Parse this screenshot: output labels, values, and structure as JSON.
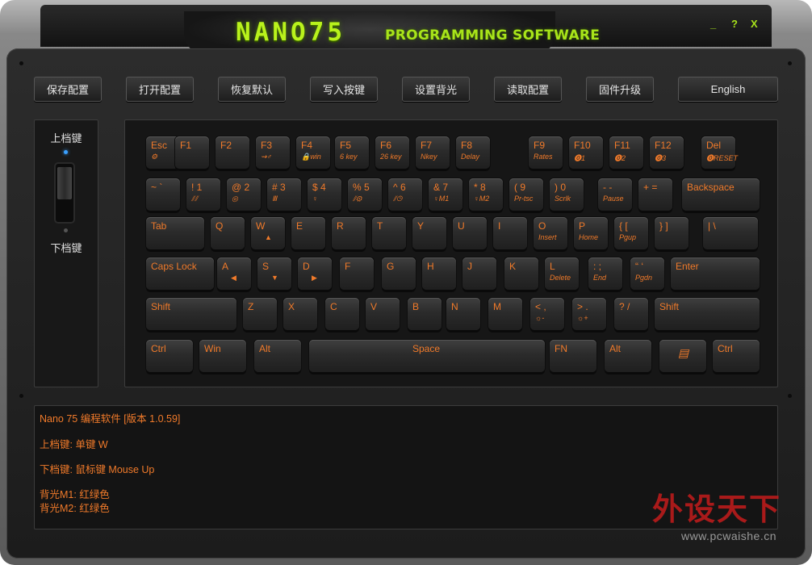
{
  "window": {
    "logo": "NANO75",
    "subtitle": "PROGRAMMING SOFTWARE",
    "minimize": "_",
    "help": "?",
    "close": "X"
  },
  "toolbar": [
    "保存配置",
    "打开配置",
    "恢复默认",
    "写入按键",
    "设置背光",
    "读取配置",
    "固件升级",
    "English"
  ],
  "side": {
    "upper": "上档键",
    "lower": "下档键"
  },
  "keys": [
    {
      "label": "Esc",
      "sub": "⚙"
    },
    {
      "label": "F1",
      "sub": ""
    },
    {
      "label": "F2",
      "sub": ""
    },
    {
      "label": "F3",
      "sub": "⇝♂"
    },
    {
      "label": "F4",
      "sub": "🔒win"
    },
    {
      "label": "F5",
      "sub": "6 key"
    },
    {
      "label": "F6",
      "sub": "26 key"
    },
    {
      "label": "F7",
      "sub": "Nkey"
    },
    {
      "label": "F8",
      "sub": "Delay"
    },
    {
      "label": "F9",
      "sub": "Rates"
    },
    {
      "label": "F10",
      "sub": "⓿1"
    },
    {
      "label": "F11",
      "sub": "⓿2"
    },
    {
      "label": "F12",
      "sub": "⓿3"
    },
    {
      "label": "Del",
      "sub": "⓿RESET"
    },
    {
      "label": "~  `",
      "sub": ""
    },
    {
      "label": "!   1",
      "sub": "⫽⫽"
    },
    {
      "label": "@  2",
      "sub": "◎"
    },
    {
      "label": "#  3",
      "sub": "Ⅲ"
    },
    {
      "label": "$  4",
      "sub": "♀"
    },
    {
      "label": "%  5",
      "sub": "⫽⚙"
    },
    {
      "label": "^  6",
      "sub": "⫽◷"
    },
    {
      "label": "&  7",
      "sub": "♀M1"
    },
    {
      "label": "*   8",
      "sub": "♀M2"
    },
    {
      "label": "(  9",
      "sub": "Pr-tsc"
    },
    {
      "label": ")  0",
      "sub": "Scrlk"
    },
    {
      "label": "-   -",
      "sub": "Pause"
    },
    {
      "label": "+  =",
      "sub": ""
    },
    {
      "label": "Backspace",
      "sub": ""
    },
    {
      "label": "Tab",
      "sub": ""
    },
    {
      "label": "Q",
      "sub": ""
    },
    {
      "label": "W",
      "sub": "▲"
    },
    {
      "label": "E",
      "sub": ""
    },
    {
      "label": "R",
      "sub": ""
    },
    {
      "label": "T",
      "sub": ""
    },
    {
      "label": "Y",
      "sub": ""
    },
    {
      "label": "U",
      "sub": ""
    },
    {
      "label": "I",
      "sub": ""
    },
    {
      "label": "O",
      "sub": "Insert"
    },
    {
      "label": "P",
      "sub": "Home"
    },
    {
      "label": "{  [",
      "sub": "Pgup"
    },
    {
      "label": "}  ]",
      "sub": ""
    },
    {
      "label": "|  \\",
      "sub": ""
    },
    {
      "label": "Caps Lock",
      "sub": ""
    },
    {
      "label": "A",
      "sub": "◀"
    },
    {
      "label": "S",
      "sub": "▼"
    },
    {
      "label": "D",
      "sub": "▶"
    },
    {
      "label": "F",
      "sub": ""
    },
    {
      "label": "G",
      "sub": ""
    },
    {
      "label": "H",
      "sub": ""
    },
    {
      "label": "J",
      "sub": ""
    },
    {
      "label": "K",
      "sub": ""
    },
    {
      "label": "L",
      "sub": "Delete"
    },
    {
      "label": ":  ;",
      "sub": "End"
    },
    {
      "label": "“ ‘",
      "sub": "Pgdn"
    },
    {
      "label": "Enter",
      "sub": ""
    },
    {
      "label": "Shift",
      "sub": ""
    },
    {
      "label": "Z",
      "sub": ""
    },
    {
      "label": "X",
      "sub": ""
    },
    {
      "label": "C",
      "sub": ""
    },
    {
      "label": "V",
      "sub": ""
    },
    {
      "label": "B",
      "sub": ""
    },
    {
      "label": "N",
      "sub": ""
    },
    {
      "label": "M",
      "sub": ""
    },
    {
      "label": "<  ,",
      "sub": "☼-"
    },
    {
      "label": ">  .",
      "sub": "☼+"
    },
    {
      "label": "?  /",
      "sub": ""
    },
    {
      "label": "Shift",
      "sub": ""
    },
    {
      "label": "Ctrl",
      "sub": ""
    },
    {
      "label": "Win",
      "sub": ""
    },
    {
      "label": "Alt",
      "sub": ""
    },
    {
      "label": "Space",
      "sub": ""
    },
    {
      "label": "FN",
      "sub": ""
    },
    {
      "label": "Alt",
      "sub": ""
    },
    {
      "label": "",
      "sub": "▤"
    },
    {
      "label": "Ctrl",
      "sub": ""
    }
  ],
  "log": [
    "Nano 75 编程软件 [版本 1.0.59]",
    "上档键: 单键 W",
    "下档键: 鼠标键 Mouse Up",
    "背光M1: 红绿色",
    "背光M2: 红绿色"
  ],
  "watermark": {
    "text": "外设天下",
    "url": "www.pcwaishe.cn"
  },
  "colors": {
    "accent": "#f07a2a",
    "logo": "#b9f21c",
    "led_blue": "#3aa0ff",
    "watermark": "#c41c1c"
  }
}
